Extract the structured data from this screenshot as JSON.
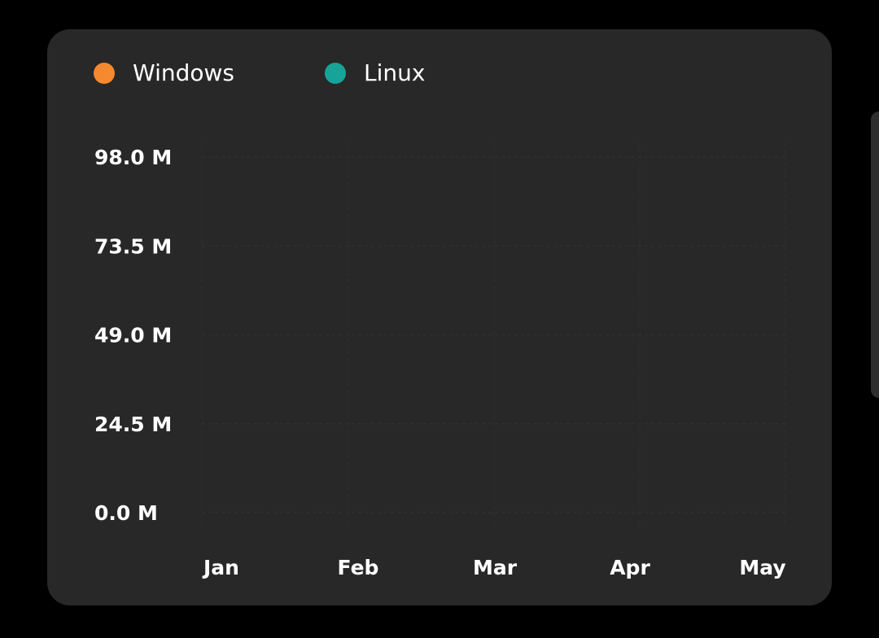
{
  "colors": {
    "windows": "#f5892e",
    "linux": "#17a398"
  },
  "chart_data": {
    "type": "line",
    "categories": [
      "Jan",
      "Feb",
      "Mar",
      "Apr",
      "May"
    ],
    "series": [
      {
        "name": "Windows",
        "values": []
      },
      {
        "name": "Linux",
        "values": []
      }
    ],
    "y_ticks": [
      "0.0 M",
      "24.5 M",
      "49.0 M",
      "73.5 M",
      "98.0 M"
    ],
    "ylim": [
      0,
      98000000
    ],
    "grid": true,
    "legend": "top-left"
  }
}
